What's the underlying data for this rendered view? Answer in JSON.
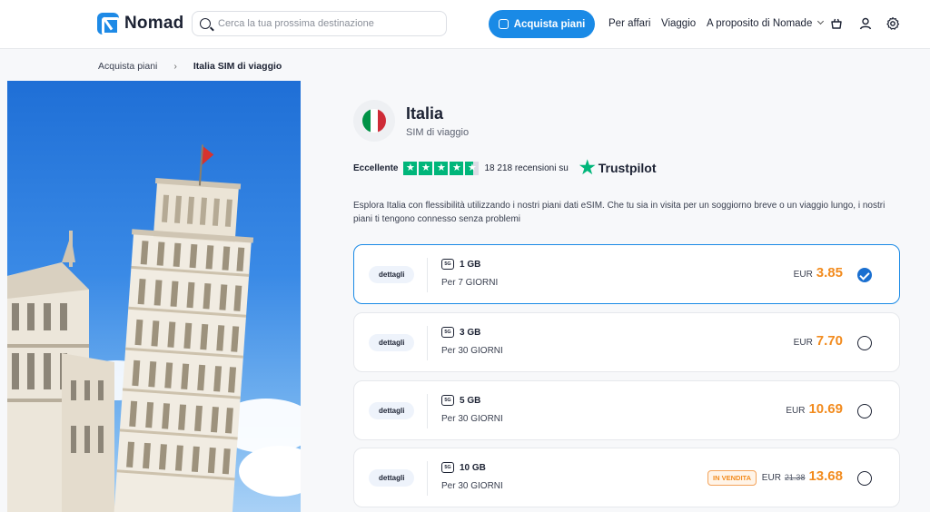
{
  "header": {
    "brand": "Nomad",
    "search_placeholder": "Cerca la tua prossima destinazione",
    "cta_label": "Acquista piani",
    "nav": [
      "Per affari",
      "Viaggio",
      "A proposito di Nomade"
    ]
  },
  "breadcrumb": [
    "Acquista piani",
    "Italia SIM di viaggio"
  ],
  "country": {
    "name": "Italia",
    "subtitle": "SIM di viaggio",
    "flag_colors": [
      "#009246",
      "#ffffff",
      "#ce2b37"
    ]
  },
  "rating": {
    "label": "Eccellente",
    "stars": 4.5,
    "reviews": "18 218 recensioni su",
    "provider": "Trustpilot"
  },
  "description": "Esplora Italia con flessibilità utilizzando i nostri piani dati eSIM. Che tu sia in visita per un soggiorno breve o un viaggio lungo, i nostri piani ti tengono connesso senza problemi",
  "plans": [
    {
      "details": "dettagli",
      "network": "5G",
      "data": "1 GB",
      "duration": "Per 7 GIORNI",
      "currency": "EUR",
      "price": "3.85",
      "selected": true
    },
    {
      "details": "dettagli",
      "network": "5G",
      "data": "3 GB",
      "duration": "Per 30 GIORNI",
      "currency": "EUR",
      "price": "7.70",
      "selected": false
    },
    {
      "details": "dettagli",
      "network": "5G",
      "data": "5 GB",
      "duration": "Per 30 GIORNI",
      "currency": "EUR",
      "price": "10.69",
      "selected": false
    },
    {
      "details": "dettagli",
      "network": "5G",
      "data": "10 GB",
      "duration": "Per 30 GIORNI",
      "currency": "EUR",
      "old_price": "21.38",
      "price": "13.68",
      "badge": "IN VENDITA",
      "selected": false
    }
  ],
  "colors": {
    "accent": "#1a8ae6",
    "price": "#f28b1e",
    "trustpilot": "#00b67a"
  }
}
